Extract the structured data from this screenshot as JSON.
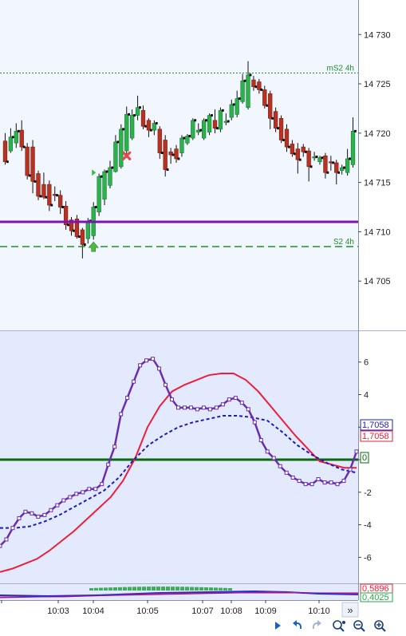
{
  "colors": {
    "price_bg": "#f2f6ff",
    "osc_bg": "#e4eafd",
    "bull": "#2bb24c",
    "bear": "#b83222",
    "purple_line": "#7d12b5",
    "resistance": "#1f8f2a",
    "osc_main": "#6a2cb0",
    "osc_signal": "#1b1bc4",
    "osc_slow": "#ee1d3a",
    "zero_line": "#0a6b0a",
    "grid": "#d0d7ea"
  },
  "chart_data": [
    {
      "type": "candlestick",
      "panel": "price",
      "ylim": [
        14700,
        14733.5
      ],
      "ytick_labels": [
        "14 730",
        "14 725",
        "14 720",
        "14 715",
        "14 710",
        "14 705"
      ],
      "yticks": [
        14730,
        14725,
        14720,
        14715,
        14710,
        14705
      ],
      "levels": [
        {
          "name": "mS2 4h",
          "value": 14726.1,
          "style": "dotted"
        },
        {
          "name": "S2 4h",
          "value": 14708.5,
          "style": "dashed"
        },
        {
          "name": "",
          "value": 14711.0,
          "style": "solid"
        }
      ],
      "candles": [
        [
          14719.2,
          14717.1,
          14716.8,
          14720.0
        ],
        [
          14718.2,
          14719.6,
          14718.0,
          14720.5
        ],
        [
          14719.0,
          14720.2,
          14718.5,
          14721.0
        ],
        [
          14720.3,
          14718.6,
          14718.2,
          14721.3
        ],
        [
          14718.6,
          14715.7,
          14715.3,
          14719.0
        ],
        [
          14718.6,
          14715.1,
          14713.9,
          14719.3
        ],
        [
          14715.9,
          14713.6,
          14713.2,
          14716.2
        ],
        [
          14714.8,
          14713.5,
          14713.3,
          14716.0
        ],
        [
          14714.8,
          14712.7,
          14712.1,
          14715.2
        ],
        [
          14713.8,
          14713.7,
          14713.1,
          14714.6
        ],
        [
          14713.7,
          14712.5,
          14711.8,
          14714.2
        ],
        [
          14712.6,
          14710.7,
          14710.2,
          14713.1
        ],
        [
          14711.2,
          14710.1,
          14709.6,
          14711.5
        ],
        [
          14711.3,
          14709.5,
          14709.3,
          14711.7
        ],
        [
          14710.2,
          14708.7,
          14707.3,
          14710.4
        ],
        [
          14709.3,
          14711.1,
          14708.8,
          14711.4
        ],
        [
          14709.6,
          14712.5,
          14709.2,
          14713.0
        ],
        [
          14712.0,
          14715.6,
          14711.6,
          14715.9
        ],
        [
          14713.3,
          14716.1,
          14712.7,
          14716.3
        ],
        [
          14714.7,
          14716.5,
          14714.4,
          14717.2
        ],
        [
          14716.1,
          14719.1,
          14716.0,
          14719.8
        ],
        [
          14716.6,
          14720.4,
          14716.4,
          14720.9
        ],
        [
          14718.2,
          14721.9,
          14717.5,
          14722.7
        ],
        [
          14719.5,
          14721.8,
          14719.3,
          14722.4
        ],
        [
          14721.8,
          14722.6,
          14721.3,
          14723.8
        ],
        [
          14722.3,
          14720.7,
          14720.4,
          14722.8
        ],
        [
          14721.3,
          14720.3,
          14719.6,
          14721.5
        ],
        [
          14720.3,
          14721.0,
          14719.8,
          14721.3
        ],
        [
          14720.4,
          14718.0,
          14717.4,
          14720.7
        ],
        [
          14719.3,
          14716.3,
          14715.6,
          14719.8
        ],
        [
          14718.1,
          14717.8,
          14716.9,
          14718.5
        ],
        [
          14718.4,
          14717.4,
          14717.0,
          14718.8
        ],
        [
          14718.0,
          14719.5,
          14717.6,
          14719.8
        ],
        [
          14719.0,
          14719.7,
          14718.8,
          14719.9
        ],
        [
          14719.5,
          14721.3,
          14719.3,
          14721.5
        ],
        [
          14720.1,
          14720.3,
          14719.8,
          14721.0
        ],
        [
          14719.5,
          14721.3,
          14719.3,
          14721.5
        ],
        [
          14720.1,
          14721.8,
          14719.8,
          14722.0
        ],
        [
          14721.3,
          14720.5,
          14720.0,
          14722.4
        ],
        [
          14720.4,
          14722.3,
          14720.1,
          14722.6
        ],
        [
          14721.2,
          14721.2,
          14720.8,
          14722.0
        ],
        [
          14721.6,
          14722.9,
          14721.3,
          14723.4
        ],
        [
          14721.9,
          14723.5,
          14721.6,
          14724.3
        ],
        [
          14723.2,
          14725.3,
          14723.0,
          14726.0
        ],
        [
          14722.6,
          14725.9,
          14722.4,
          14727.3
        ],
        [
          14725.4,
          14724.7,
          14724.3,
          14725.8
        ],
        [
          14725.2,
          14724.4,
          14724.0,
          14725.5
        ],
        [
          14724.4,
          14722.8,
          14722.5,
          14724.8
        ],
        [
          14724.0,
          14721.5,
          14720.4,
          14724.3
        ],
        [
          14722.2,
          14720.5,
          14720.1,
          14722.6
        ],
        [
          14721.5,
          14719.3,
          14719.0,
          14721.8
        ],
        [
          14720.4,
          14718.6,
          14718.1,
          14720.9
        ],
        [
          14718.9,
          14717.9,
          14717.6,
          14719.3
        ],
        [
          14718.4,
          14717.3,
          14715.9,
          14719.0
        ],
        [
          14718.6,
          14718.1,
          14717.6,
          14718.9
        ],
        [
          14718.2,
          14716.6,
          14715.1,
          14718.5
        ],
        [
          14717.6,
          14717.6,
          14717.2,
          14718.1
        ],
        [
          14717.1,
          14717.5,
          14716.8,
          14717.7
        ],
        [
          14717.7,
          14716.0,
          14715.4,
          14718.0
        ],
        [
          14717.1,
          14717.0,
          14716.2,
          14717.7
        ],
        [
          14717.0,
          14716.0,
          14714.8,
          14717.3
        ],
        [
          14716.2,
          14716.5,
          14715.8,
          14716.8
        ],
        [
          14716.0,
          14717.4,
          14715.7,
          14718.4
        ],
        [
          14716.8,
          14720.2,
          14716.5,
          14721.6
        ]
      ],
      "markers": [
        {
          "type": "buy-arrow",
          "index": 16,
          "value": 14708.4
        },
        {
          "type": "sell-cross",
          "index": 22,
          "value": 14717.7
        },
        {
          "type": "triangle",
          "index": 16,
          "value": 14716.0
        }
      ]
    },
    {
      "type": "line",
      "panel": "oscillator",
      "ylim": [
        -7.6,
        7.9
      ],
      "ytick_labels": [
        "6",
        "4",
        "2",
        "0",
        "-2",
        "-4",
        "-6"
      ],
      "yticks": [
        6,
        4,
        2,
        0,
        -2,
        -4,
        -6
      ],
      "series": [
        {
          "name": "",
          "role": "main",
          "values": [
            -5.3,
            -4.9,
            -4.2,
            -3.6,
            -3.2,
            -3.3,
            -3.5,
            -3.4,
            -3.1,
            -2.8,
            -2.5,
            -2.3,
            -2.1,
            -2.0,
            -1.8,
            -1.8,
            -1.5,
            -0.3,
            0.8,
            2.8,
            3.8,
            4.8,
            5.8,
            6.1,
            6.2,
            5.6,
            4.6,
            3.7,
            3.2,
            3.2,
            3.2,
            3.1,
            3.2,
            3.1,
            3.2,
            3.4,
            3.7,
            3.8,
            3.5,
            3.1,
            2.3,
            1.2,
            0.5,
            0.1,
            -0.4,
            -0.8,
            -1.1,
            -1.3,
            -1.5,
            -1.5,
            -1.2,
            -1.4,
            -1.4,
            -1.5,
            -1.3,
            -0.6,
            0.5
          ]
        },
        {
          "name": "",
          "role": "signal",
          "values": [
            -4.2,
            -4.2,
            -4.1,
            -3.8,
            -3.4,
            -2.9,
            -2.4,
            -1.9,
            -1.1,
            0.0,
            0.9,
            1.5,
            2.0,
            2.3,
            2.5,
            2.7,
            2.7,
            2.6,
            2.4,
            1.7,
            0.9,
            0.3,
            -0.2,
            -0.6,
            -0.8
          ]
        },
        {
          "name": "",
          "role": "slow",
          "values": [
            -6.9,
            -6.7,
            -6.4,
            -6.1,
            -5.6,
            -5.0,
            -4.4,
            -3.7,
            -3.0,
            -2.3,
            -1.3,
            0.1,
            2.0,
            3.3,
            4.2,
            4.6,
            4.9,
            5.2,
            5.3,
            5.3,
            4.9,
            4.2,
            3.3,
            2.4,
            1.5,
            0.7,
            -0.1,
            -0.3,
            -0.5,
            -0.5
          ]
        }
      ],
      "value_tags": [
        "1,7058",
        "1,7058",
        "0"
      ]
    }
  ],
  "sub_panel": {
    "value_tags": [
      "0,5896",
      "0,4025"
    ]
  },
  "x_axis": {
    "tick_labels": [
      "10:03",
      "10:04",
      "10:05",
      "10:07",
      "10:08",
      "10:09",
      "10:10"
    ]
  },
  "toolbar": {
    "more_label": "»",
    "buttons": [
      {
        "name": "play-icon"
      },
      {
        "name": "undo-icon"
      },
      {
        "name": "redo-icon"
      },
      {
        "name": "zoom-reset-icon"
      },
      {
        "name": "zoom-out-icon"
      },
      {
        "name": "zoom-in-icon"
      }
    ]
  }
}
